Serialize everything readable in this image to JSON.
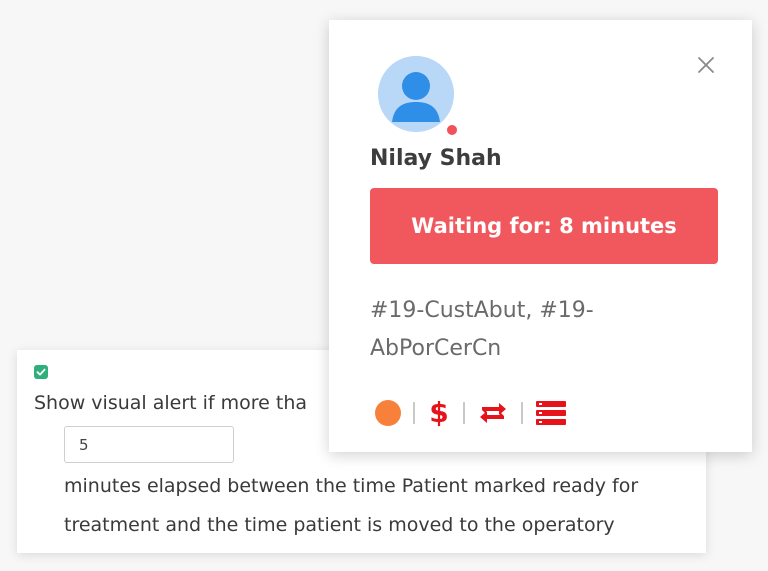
{
  "settings": {
    "checkbox_checked": true,
    "alert_label": "Show visual alert if more tha",
    "minutes_value": "5",
    "description_line1": "minutes elapsed between the time Patient marked ready for",
    "description_line2": "treatment and the time patient is moved to the operatory"
  },
  "patient_card": {
    "close_icon": "close-icon",
    "avatar_icon": "user-avatar-icon",
    "status_color": "#f0515b",
    "name": "Nilay Shah",
    "waiting_text": "Waiting for: 8 minutes",
    "waiting_color": "#f0585e",
    "codes": "#19-CustAbut, #19-AbPorCerCn",
    "icons": [
      {
        "name": "status-dot-icon",
        "color": "#f7813b"
      },
      {
        "name": "dollar-icon",
        "color": "#e7131a",
        "glyph": "$"
      },
      {
        "name": "repeat-icon",
        "color": "#e7131a"
      },
      {
        "name": "list-icon",
        "color": "#e7131a"
      }
    ]
  },
  "colors": {
    "accent_red": "#e7131a",
    "checkbox_green": "#2fb07a",
    "background": "#f7f7f7"
  }
}
